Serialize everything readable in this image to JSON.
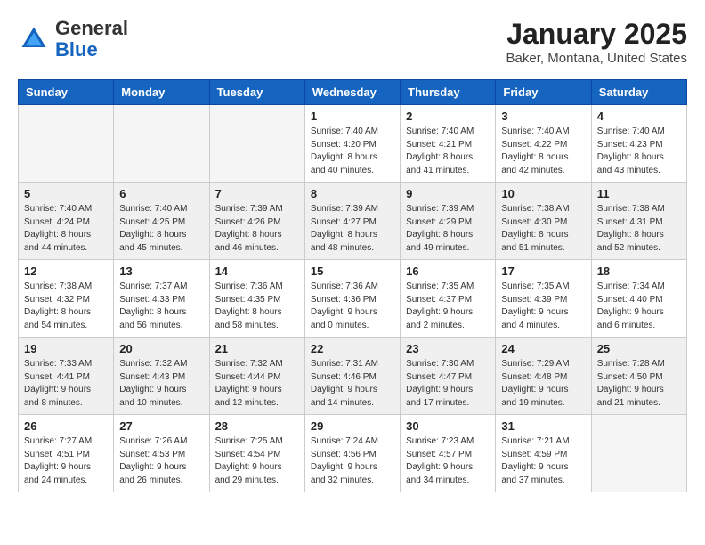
{
  "logo": {
    "general": "General",
    "blue": "Blue"
  },
  "title": "January 2025",
  "location": "Baker, Montana, United States",
  "days_of_week": [
    "Sunday",
    "Monday",
    "Tuesday",
    "Wednesday",
    "Thursday",
    "Friday",
    "Saturday"
  ],
  "weeks": [
    [
      {
        "num": "",
        "info": ""
      },
      {
        "num": "",
        "info": ""
      },
      {
        "num": "",
        "info": ""
      },
      {
        "num": "1",
        "info": "Sunrise: 7:40 AM\nSunset: 4:20 PM\nDaylight: 8 hours\nand 40 minutes."
      },
      {
        "num": "2",
        "info": "Sunrise: 7:40 AM\nSunset: 4:21 PM\nDaylight: 8 hours\nand 41 minutes."
      },
      {
        "num": "3",
        "info": "Sunrise: 7:40 AM\nSunset: 4:22 PM\nDaylight: 8 hours\nand 42 minutes."
      },
      {
        "num": "4",
        "info": "Sunrise: 7:40 AM\nSunset: 4:23 PM\nDaylight: 8 hours\nand 43 minutes."
      }
    ],
    [
      {
        "num": "5",
        "info": "Sunrise: 7:40 AM\nSunset: 4:24 PM\nDaylight: 8 hours\nand 44 minutes."
      },
      {
        "num": "6",
        "info": "Sunrise: 7:40 AM\nSunset: 4:25 PM\nDaylight: 8 hours\nand 45 minutes."
      },
      {
        "num": "7",
        "info": "Sunrise: 7:39 AM\nSunset: 4:26 PM\nDaylight: 8 hours\nand 46 minutes."
      },
      {
        "num": "8",
        "info": "Sunrise: 7:39 AM\nSunset: 4:27 PM\nDaylight: 8 hours\nand 48 minutes."
      },
      {
        "num": "9",
        "info": "Sunrise: 7:39 AM\nSunset: 4:29 PM\nDaylight: 8 hours\nand 49 minutes."
      },
      {
        "num": "10",
        "info": "Sunrise: 7:38 AM\nSunset: 4:30 PM\nDaylight: 8 hours\nand 51 minutes."
      },
      {
        "num": "11",
        "info": "Sunrise: 7:38 AM\nSunset: 4:31 PM\nDaylight: 8 hours\nand 52 minutes."
      }
    ],
    [
      {
        "num": "12",
        "info": "Sunrise: 7:38 AM\nSunset: 4:32 PM\nDaylight: 8 hours\nand 54 minutes."
      },
      {
        "num": "13",
        "info": "Sunrise: 7:37 AM\nSunset: 4:33 PM\nDaylight: 8 hours\nand 56 minutes."
      },
      {
        "num": "14",
        "info": "Sunrise: 7:36 AM\nSunset: 4:35 PM\nDaylight: 8 hours\nand 58 minutes."
      },
      {
        "num": "15",
        "info": "Sunrise: 7:36 AM\nSunset: 4:36 PM\nDaylight: 9 hours\nand 0 minutes."
      },
      {
        "num": "16",
        "info": "Sunrise: 7:35 AM\nSunset: 4:37 PM\nDaylight: 9 hours\nand 2 minutes."
      },
      {
        "num": "17",
        "info": "Sunrise: 7:35 AM\nSunset: 4:39 PM\nDaylight: 9 hours\nand 4 minutes."
      },
      {
        "num": "18",
        "info": "Sunrise: 7:34 AM\nSunset: 4:40 PM\nDaylight: 9 hours\nand 6 minutes."
      }
    ],
    [
      {
        "num": "19",
        "info": "Sunrise: 7:33 AM\nSunset: 4:41 PM\nDaylight: 9 hours\nand 8 minutes."
      },
      {
        "num": "20",
        "info": "Sunrise: 7:32 AM\nSunset: 4:43 PM\nDaylight: 9 hours\nand 10 minutes."
      },
      {
        "num": "21",
        "info": "Sunrise: 7:32 AM\nSunset: 4:44 PM\nDaylight: 9 hours\nand 12 minutes."
      },
      {
        "num": "22",
        "info": "Sunrise: 7:31 AM\nSunset: 4:46 PM\nDaylight: 9 hours\nand 14 minutes."
      },
      {
        "num": "23",
        "info": "Sunrise: 7:30 AM\nSunset: 4:47 PM\nDaylight: 9 hours\nand 17 minutes."
      },
      {
        "num": "24",
        "info": "Sunrise: 7:29 AM\nSunset: 4:48 PM\nDaylight: 9 hours\nand 19 minutes."
      },
      {
        "num": "25",
        "info": "Sunrise: 7:28 AM\nSunset: 4:50 PM\nDaylight: 9 hours\nand 21 minutes."
      }
    ],
    [
      {
        "num": "26",
        "info": "Sunrise: 7:27 AM\nSunset: 4:51 PM\nDaylight: 9 hours\nand 24 minutes."
      },
      {
        "num": "27",
        "info": "Sunrise: 7:26 AM\nSunset: 4:53 PM\nDaylight: 9 hours\nand 26 minutes."
      },
      {
        "num": "28",
        "info": "Sunrise: 7:25 AM\nSunset: 4:54 PM\nDaylight: 9 hours\nand 29 minutes."
      },
      {
        "num": "29",
        "info": "Sunrise: 7:24 AM\nSunset: 4:56 PM\nDaylight: 9 hours\nand 32 minutes."
      },
      {
        "num": "30",
        "info": "Sunrise: 7:23 AM\nSunset: 4:57 PM\nDaylight: 9 hours\nand 34 minutes."
      },
      {
        "num": "31",
        "info": "Sunrise: 7:21 AM\nSunset: 4:59 PM\nDaylight: 9 hours\nand 37 minutes."
      },
      {
        "num": "",
        "info": ""
      }
    ]
  ]
}
